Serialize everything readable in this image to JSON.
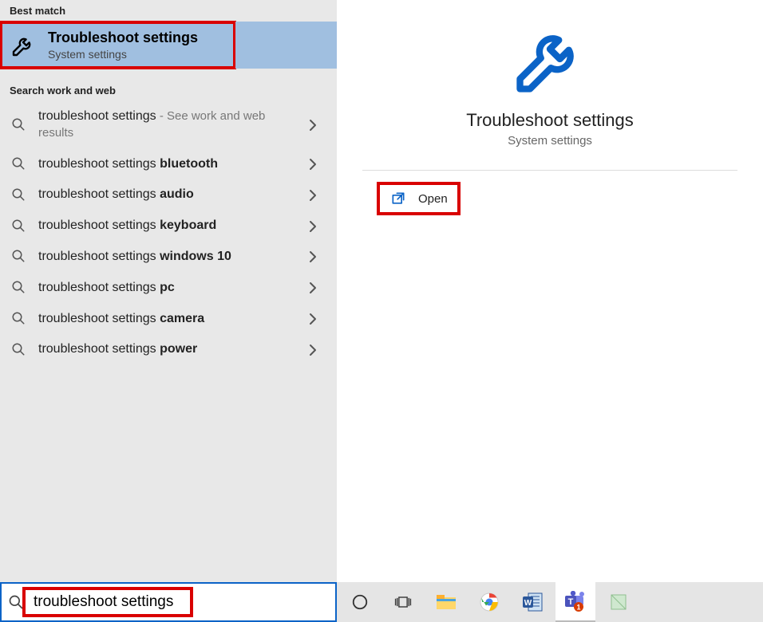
{
  "left": {
    "best_match_header": "Best match",
    "best_match": {
      "title": "Troubleshoot settings",
      "sub": "System settings"
    },
    "search_header": "Search work and web",
    "suggestions": [
      {
        "prefix": "troubleshoot settings",
        "bold": "",
        "suffix": " - See work and web results"
      },
      {
        "prefix": "troubleshoot settings ",
        "bold": "bluetooth",
        "suffix": ""
      },
      {
        "prefix": "troubleshoot settings ",
        "bold": "audio",
        "suffix": ""
      },
      {
        "prefix": "troubleshoot settings ",
        "bold": "keyboard",
        "suffix": ""
      },
      {
        "prefix": "troubleshoot settings ",
        "bold": "windows 10",
        "suffix": ""
      },
      {
        "prefix": "troubleshoot settings ",
        "bold": "pc",
        "suffix": ""
      },
      {
        "prefix": "troubleshoot settings ",
        "bold": "camera",
        "suffix": ""
      },
      {
        "prefix": "troubleshoot settings ",
        "bold": "power",
        "suffix": ""
      }
    ]
  },
  "right": {
    "title": "Troubleshoot settings",
    "sub": "System settings",
    "open_label": "Open"
  },
  "search": {
    "value": "troubleshoot settings"
  },
  "taskbar_icons": [
    "cortana-icon",
    "taskview-icon",
    "explorer-icon",
    "chrome-icon",
    "word-icon",
    "teams-icon",
    "notes-icon"
  ],
  "colors": {
    "accent": "#0b63c7",
    "highlight_box": "#d90000",
    "selected_bg": "#a0bfe0"
  }
}
